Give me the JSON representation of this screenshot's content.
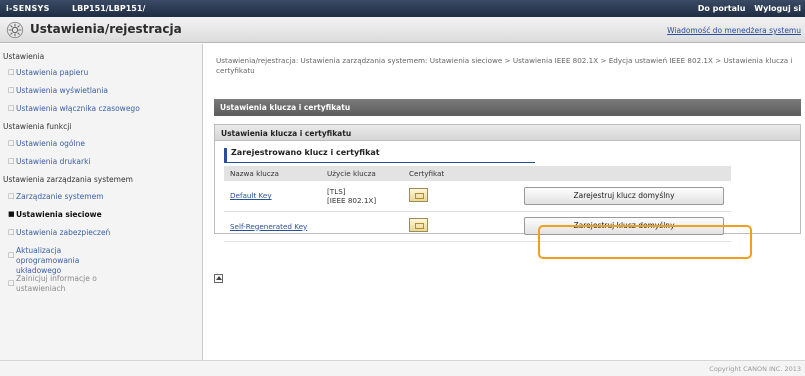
{
  "topbar": {
    "brand": "i-SENSYS",
    "model": "LBP151/LBP151/",
    "portal_link": "Do portalu",
    "logout_link": "Wyloguj si"
  },
  "header": {
    "title": "Ustawienia/rejestracja",
    "message_link": "Wiadomość do menedżera systemu"
  },
  "sidebar": {
    "sections": [
      {
        "heading": "Ustawienia",
        "items": [
          {
            "label": "Ustawienia papieru"
          },
          {
            "label": "Ustawienia wyświetlania"
          },
          {
            "label": "Ustawienia włącznika czasowego"
          }
        ]
      },
      {
        "heading": "Ustawienia funkcji",
        "items": [
          {
            "label": "Ustawienia ogólne"
          },
          {
            "label": "Ustawienia drukarki"
          }
        ]
      },
      {
        "heading": "Ustawienia zarządzania systemem",
        "items": [
          {
            "label": "Zarządzanie systemem"
          },
          {
            "label": "Ustawienia sieciowe"
          },
          {
            "label": "Ustawienia zabezpieczeń"
          },
          {
            "label": "Aktualizacja oprogramowania układowego"
          },
          {
            "label": "Zainicjuj informacje o ustawieniach"
          }
        ]
      }
    ]
  },
  "main": {
    "breadcrumb": "Ustawienia/rejestracja: Ustawienia zarządzania systemem: Ustawienia sieciowe > Ustawienia IEEE 802.1X > Edycja ustawień IEEE 802.1X > Ustawienia klucza i certyfikatu",
    "section_title": "Ustawienia klucza i certyfikatu",
    "panel_title": "Ustawienia klucza i certyfikatu",
    "subsection_title": "Zarejestrowano klucz i certyfikat",
    "columns": [
      "Nazwa klucza",
      "Użycie klucza",
      "Certyfikat",
      ""
    ],
    "rows": [
      {
        "key_name": "Default Key",
        "usage_line1": "[TLS]",
        "usage_line2": "[IEEE 802.1X]",
        "button": "Zarejestruj klucz domyślny"
      },
      {
        "key_name": "Self-Regenerated Key",
        "usage_line1": "",
        "usage_line2": "",
        "button": "Zarejestruj klucz domyślny"
      }
    ],
    "highlight_color": "#f0a020"
  },
  "footer": {
    "copyright": "Copyright CANON INC. 2013"
  },
  "colors": {
    "link": "#2a4f9a",
    "topbar": "#1f2c42"
  }
}
